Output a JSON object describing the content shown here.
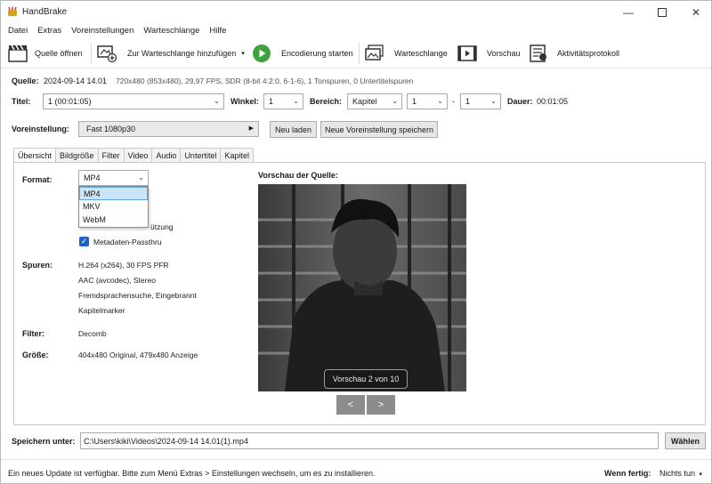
{
  "window": {
    "title": "HandBrake"
  },
  "menu": [
    "Datei",
    "Extras",
    "Voreinstellungen",
    "Warteschlange",
    "Hilfe"
  ],
  "toolbar": {
    "open_source": "Quelle öffnen",
    "add_queue": "Zur Warteschlange hinzufügen",
    "start": "Encodierung starten",
    "queue": "Warteschlange",
    "preview": "Vorschau",
    "activity": "Aktivitätsprotokoll"
  },
  "source": {
    "label": "Quelle:",
    "name": "2024-09-14 14.01",
    "info": "720x480 (853x480), 29,97 FPS, SDR (8-bit 4:2:0, 6-1-6), 1 Tonspuren, 0 Untertitelspuren"
  },
  "title_row": {
    "title_label": "Titel:",
    "title_value": "1 (00:01:05)",
    "angle_label": "Winkel:",
    "angle_value": "1",
    "range_label": "Bereich:",
    "range_type": "Kapitel",
    "range_from": "1",
    "range_sep": "-",
    "range_to": "1",
    "duration_label": "Dauer:",
    "duration_value": "00:01:05"
  },
  "preset": {
    "label": "Voreinstellung:",
    "value": "Fast 1080p30",
    "reload": "Neu laden",
    "save_new": "Neue Voreinstellung speichern"
  },
  "tabs": [
    "Übersicht",
    "Bildgröße",
    "Filter",
    "Video",
    "Audio",
    "Untertitel",
    "Kapitel"
  ],
  "summary": {
    "format_label": "Format:",
    "format_value": "MP4",
    "format_options": [
      "MP4",
      "MKV",
      "WebM"
    ],
    "partial_text": "ützung",
    "passthru_label": "Metadaten-Passthru",
    "tracks_label": "Spuren:",
    "tracks": [
      "H.264 (x264), 30 FPS PFR",
      "AAC (avcodec), Stereo",
      "Fremdsprachensuche, Eingebrannt",
      "Kapitelmarker"
    ],
    "filter_label": "Filter:",
    "filter_value": "Decomb",
    "size_label": "Größe:",
    "size_value": "404x480 Original, 479x480 Anzeige",
    "preview_label": "Vorschau der Quelle:",
    "preview_badge": "Vorschau 2 von 10",
    "prev_btn": "<",
    "next_btn": ">"
  },
  "save": {
    "label": "Speichern unter:",
    "path": "C:\\Users\\kiki\\Videos\\2024-09-14 14.01(1).mp4",
    "browse": "Wählen"
  },
  "status": {
    "message": "Ein neues Update ist verfügbar. Bitte zum Menü Extras  > Einstellungen wechseln, um es zu installieren.",
    "when_done_label": "Wenn fertig:",
    "when_done_value": "Nichts tun"
  }
}
